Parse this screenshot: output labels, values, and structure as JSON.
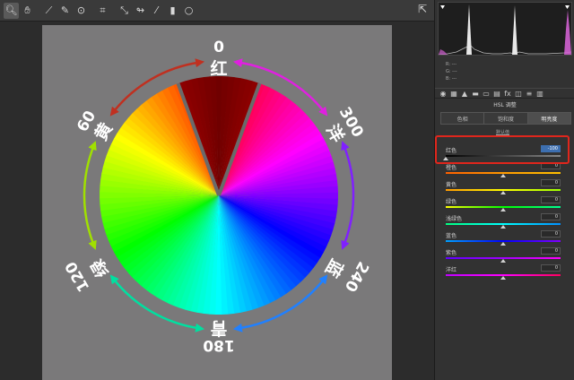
{
  "toolbar": {
    "tools": [
      {
        "name": "zoom-tool",
        "glyph": "🔍︎"
      },
      {
        "name": "hand-tool",
        "glyph": "✋︎"
      },
      {
        "name": "white-balance-tool",
        "glyph": "⟋"
      },
      {
        "name": "color-sampler-tool",
        "glyph": "✎"
      },
      {
        "name": "targeted-adjustment-tool",
        "glyph": "⊙"
      },
      {
        "name": "crop-tool",
        "glyph": "⌗"
      },
      {
        "name": "straighten-tool",
        "glyph": "⤡"
      },
      {
        "name": "spot-removal-tool",
        "glyph": "↬"
      },
      {
        "name": "redeye-tool",
        "glyph": "⁄"
      },
      {
        "name": "graduated-filter-tool",
        "glyph": "▮"
      },
      {
        "name": "radial-filter-tool",
        "glyph": "○"
      }
    ],
    "export_glyph": "⇱"
  },
  "wheel": {
    "labels": {
      "top_num": "0",
      "top_char": "红",
      "tl_num": "60",
      "tl_char": "黄",
      "tr_num": "300",
      "tr_char": "洋",
      "bl_num": "120",
      "bl_char": "绿",
      "br_num": "240",
      "br_char": "蓝",
      "bottom_num": "180",
      "bottom_char": "青"
    },
    "colors": {
      "label": "#ffffff",
      "photo_bg": "#7a797a"
    }
  },
  "panel": {
    "rgb": [
      "R: ---",
      "G: ---",
      "B: ---"
    ],
    "section_title": "HSL 调整",
    "tabs": [
      {
        "label": "色相",
        "active": false
      },
      {
        "label": "饱和度",
        "active": false
      },
      {
        "label": "明亮度",
        "active": true
      }
    ],
    "default_link": "默认值",
    "sliders": [
      {
        "label": "红色",
        "value": "-100",
        "selected": true
      },
      {
        "label": "橙色",
        "value": "0",
        "selected": false
      },
      {
        "label": "黄色",
        "value": "0",
        "selected": false
      },
      {
        "label": "绿色",
        "value": "0",
        "selected": false
      },
      {
        "label": "浅绿色",
        "value": "0",
        "selected": false
      },
      {
        "label": "蓝色",
        "value": "0",
        "selected": false
      },
      {
        "label": "紫色",
        "value": "0",
        "selected": false
      },
      {
        "label": "洋红",
        "value": "0",
        "selected": false
      }
    ],
    "highlight_color": "#e0261c"
  }
}
